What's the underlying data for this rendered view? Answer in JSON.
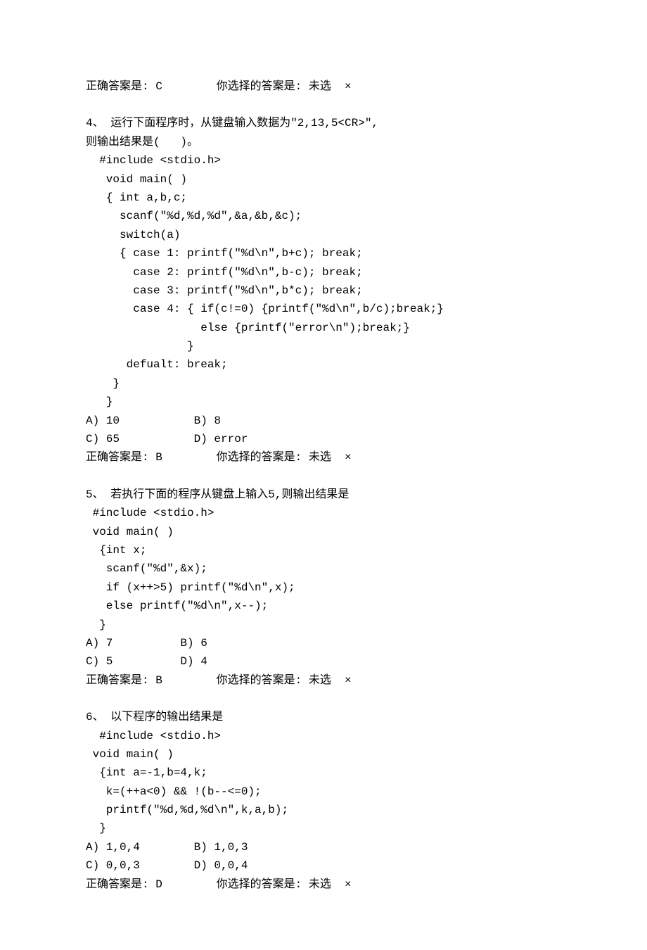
{
  "q3": {
    "answer_line": "正确答案是: C        你选择的答案是: 未选  ×"
  },
  "q4": {
    "title": "4、 运行下面程序时，从键盘输入数据为\"2,13,5<CR>\",\n则输出结果是(   )。",
    "code": "  #include <stdio.h>\n   void main( )\n   { int a,b,c;\n     scanf(\"%d,%d,%d\",&a,&b,&c);\n     switch(a)\n     { case 1: printf(\"%d\\n\",b+c); break;\n       case 2: printf(\"%d\\n\",b-c); break;\n       case 3: printf(\"%d\\n\",b*c); break;\n       case 4: { if(c!=0) {printf(\"%d\\n\",b/c);break;}\n                 else {printf(\"error\\n\");break;}\n               }\n      defualt: break;\n    }\n   }",
    "options": "A) 10           B) 8\nC) 65           D) error",
    "answer_line": "正确答案是: B        你选择的答案是: 未选  ×"
  },
  "q5": {
    "title": "5、 若执行下面的程序从键盘上输入5,则输出结果是",
    "code": " #include <stdio.h>\n void main( )\n  {int x;\n   scanf(\"%d\",&x);\n   if (x++>5) printf(\"%d\\n\",x);\n   else printf(\"%d\\n\",x--);\n  }",
    "options": "A) 7          B) 6\nC) 5          D) 4",
    "answer_line": "正确答案是: B        你选择的答案是: 未选  ×"
  },
  "q6": {
    "title": "6、 以下程序的输出结果是",
    "code": "  #include <stdio.h>\n void main( )\n  {int a=-1,b=4,k;\n   k=(++a<0) && !(b--<=0);\n   printf(\"%d,%d,%d\\n\",k,a,b);\n  }",
    "options": "A) 1,0,4        B) 1,0,3\nC) 0,0,3        D) 0,0,4",
    "answer_line": "正确答案是: D        你选择的答案是: 未选  ×"
  }
}
